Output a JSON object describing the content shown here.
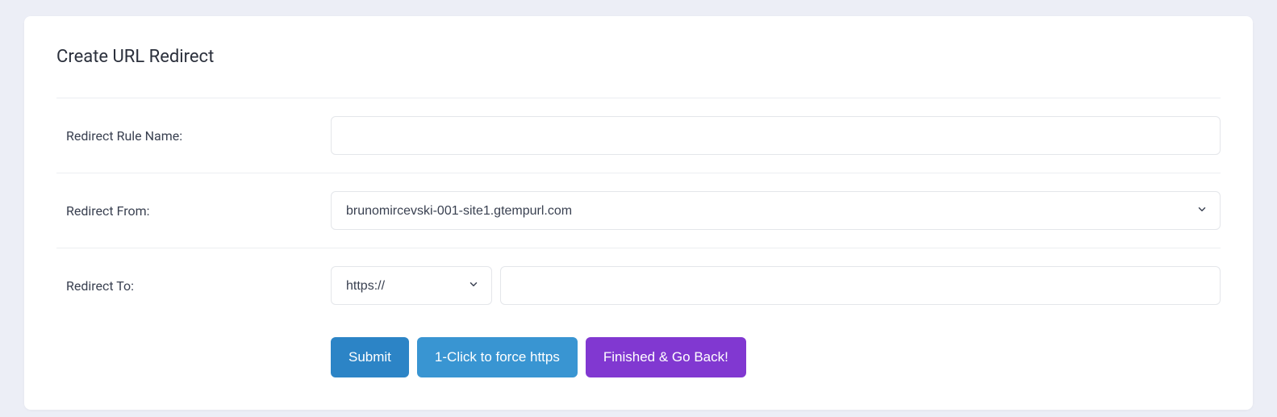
{
  "card": {
    "title": "Create URL Redirect"
  },
  "form": {
    "rule_name": {
      "label": "Redirect Rule Name:",
      "value": ""
    },
    "redirect_from": {
      "label": "Redirect From:",
      "selected": "brunomircevski-001-site1.gtempurl.com"
    },
    "redirect_to": {
      "label": "Redirect To:",
      "protocol_selected": "https://",
      "value": ""
    }
  },
  "buttons": {
    "submit": "Submit",
    "force_https": "1-Click to force https",
    "finished": "Finished & Go Back!"
  }
}
